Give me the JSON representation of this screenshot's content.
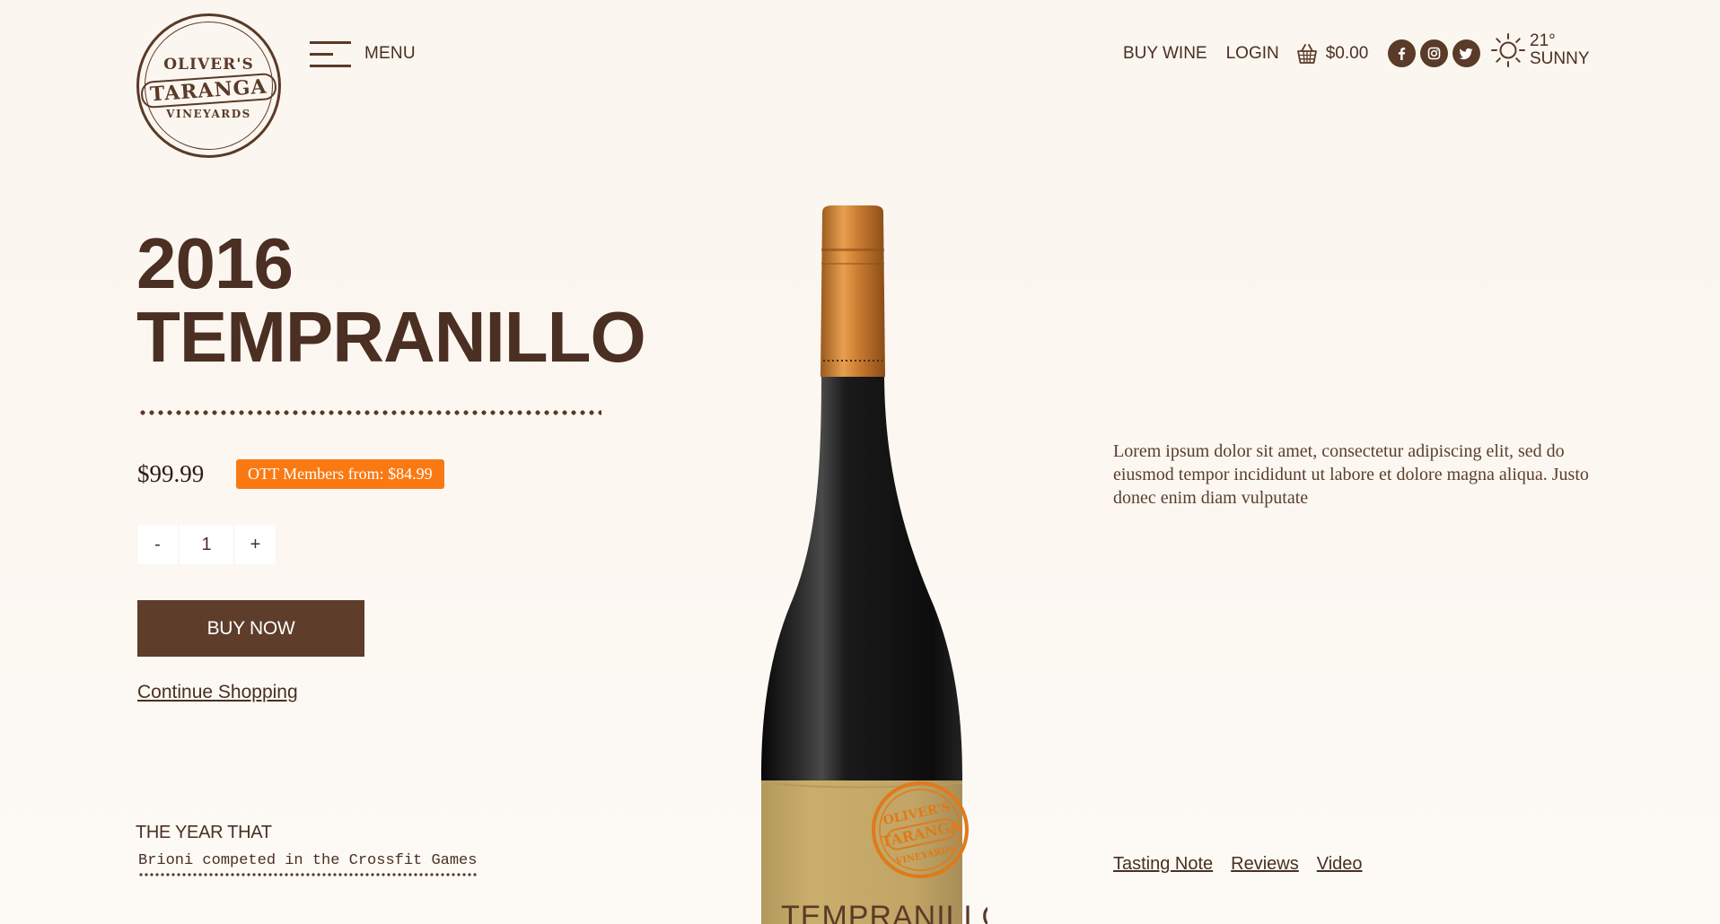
{
  "brand": {
    "logo_top": "OLIVER'S",
    "logo_mid": "TARANGA",
    "logo_bottom": "VINEYARDS"
  },
  "header": {
    "menu_label": "MENU",
    "nav": {
      "buy_wine": "BUY WINE",
      "login": "LOGIN",
      "cart_total": "$0.00"
    },
    "social_icons": [
      "facebook-icon",
      "instagram-icon",
      "twitter-icon"
    ],
    "weather": {
      "icon": "sun-icon",
      "temperature": "21°",
      "condition": "SUNNY"
    }
  },
  "product": {
    "year": "2016",
    "name": "TEMPRANILLO",
    "price": "$99.99",
    "member_price": "OTT Members from: $84.99",
    "quantity": {
      "minus": "-",
      "value": "1",
      "plus": "+"
    },
    "buy_now": "BUY NOW",
    "continue_shopping": "Continue Shopping",
    "description": "Lorem ipsum dolor sit amet, consectetur adipiscing elit, sed do eiusmod tempor incididunt ut labore et dolore magna aliqua. Justo donec enim diam vulputate",
    "bottle_label": {
      "seal_top": "OLIVER'S",
      "seal_mid": "TARANGA",
      "seal_bottom": "VINEYARDS",
      "name": "TEMPRANILLO"
    }
  },
  "year_that": {
    "label": "THE YEAR THAT",
    "fact": "Brioni competed in the Crossfit Games"
  },
  "tabs": [
    "Tasting Note",
    "Reviews",
    "Video"
  ],
  "colors": {
    "brand_brown": "#5e3d2a",
    "text_brown": "#4a2f22",
    "badge_orange": "#f97a12",
    "background": "#fbf6ef"
  }
}
